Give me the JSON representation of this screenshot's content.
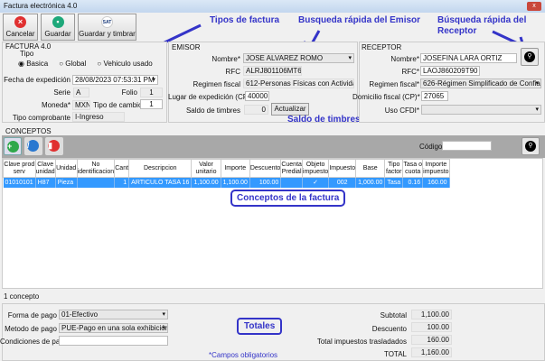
{
  "window": {
    "title": "Factura electrónica 4.0",
    "close": "x"
  },
  "toolbar": {
    "cancel": "Cancelar",
    "save": "Guardar",
    "save_stamp": "Guardar y timbrar",
    "sat": "SAT"
  },
  "annotations": {
    "tipos": "Tipos de factura",
    "emisor": "Busqueda rápida del Emisor",
    "receptor1": "Búsqueda rápida del",
    "receptor2": "Receptor",
    "saldo": "Saldo de timbres",
    "conceptos": "Conceptos de la factura",
    "totales": "Totales"
  },
  "factura": {
    "title": "FACTURA 4.0",
    "tipo_label": "Tipo",
    "tipos": [
      "Basica",
      "Global",
      "Vehiculo usado"
    ],
    "selected_tipo": "Basica",
    "fecha_label": "Fecha de expedición",
    "fecha": "28/08/2023   07:53:31  PM",
    "serie_label": "Serie",
    "serie": "A",
    "folio_label": "Folio",
    "folio": "1",
    "moneda_label": "Moneda*",
    "moneda": "MXN",
    "tc_label": "Tipo de cambio",
    "tc": "1",
    "tipo_comp_label": "Tipo comprobante",
    "tipo_comp": "I-Ingreso"
  },
  "emisor": {
    "title": "EMISOR",
    "nombre_label": "Nombre*",
    "nombre": "JOSE ALVAREZ ROMO",
    "rfc_label": "RFC",
    "rfc": "ALRJ801106MT6",
    "regimen_label": "Regimen fiscal",
    "regimen": "612-Personas Físicas con Actividades E",
    "lugar_label": "Lugar de expedición (CP)*",
    "lugar": "40000",
    "saldo_label": "Saldo de timbres",
    "saldo": "0",
    "actualizar": "Actualizar"
  },
  "receptor": {
    "title": "RECEPTOR",
    "nombre_label": "Nombre*",
    "nombre": "JOSEFINA LARA ORTIZ",
    "rfc_label": "RFC*",
    "rfc": "LAOJ860209T90",
    "regimen_label": "Regimen fiscal*",
    "regimen": "626-Régimen Simplificado de Confian:",
    "domicilio_label": "Domicilio fiscal (CP)*",
    "domicilio": "27065",
    "uso_label": "Uso CFDI*",
    "uso": ""
  },
  "conceptos": {
    "title": "CONCEPTOS",
    "codigo_label": "Código",
    "codigo": "",
    "count": "1 concepto",
    "columns": [
      "Clave prod serv",
      "Clave unidad",
      "Unidad",
      "No identificacion",
      "Cant",
      "Descripcion",
      "Valor unitario",
      "Importe",
      "Descuento",
      "Cuenta Predial",
      "Objeto impuesto",
      "Impuesto",
      "Base",
      "Tipo factor",
      "Tasa o cuota",
      "Importe impuesto"
    ],
    "rows": [
      [
        "01010101",
        "H87",
        "Pieza",
        "",
        "1",
        "ARTICULO TASA 16",
        "1,100.00",
        "1,100.00",
        "100.00",
        "",
        "✓",
        "002",
        "1,000.00",
        "Tasa",
        "0.16",
        "160.00"
      ]
    ]
  },
  "pago": {
    "forma_label": "Forma de pago",
    "forma": "01-Efectivo",
    "metodo_label": "Metodo de pago",
    "metodo": "PUE-Pago en una sola exhibición",
    "cond_label": "Condiciones de pago",
    "cond": "",
    "obligatorios": "*Campos obligatorios"
  },
  "totales": {
    "subtotal_label": "Subtotal",
    "subtotal": "1,100.00",
    "descuento_label": "Descuento",
    "descuento": "100.00",
    "impuestos_label": "Total impuestos trasladados",
    "impuestos": "160.00",
    "total_label": "TOTAL",
    "total": "1,160.00"
  },
  "colors": {
    "selection": "#3399ff",
    "annotation": "#3434c8"
  }
}
